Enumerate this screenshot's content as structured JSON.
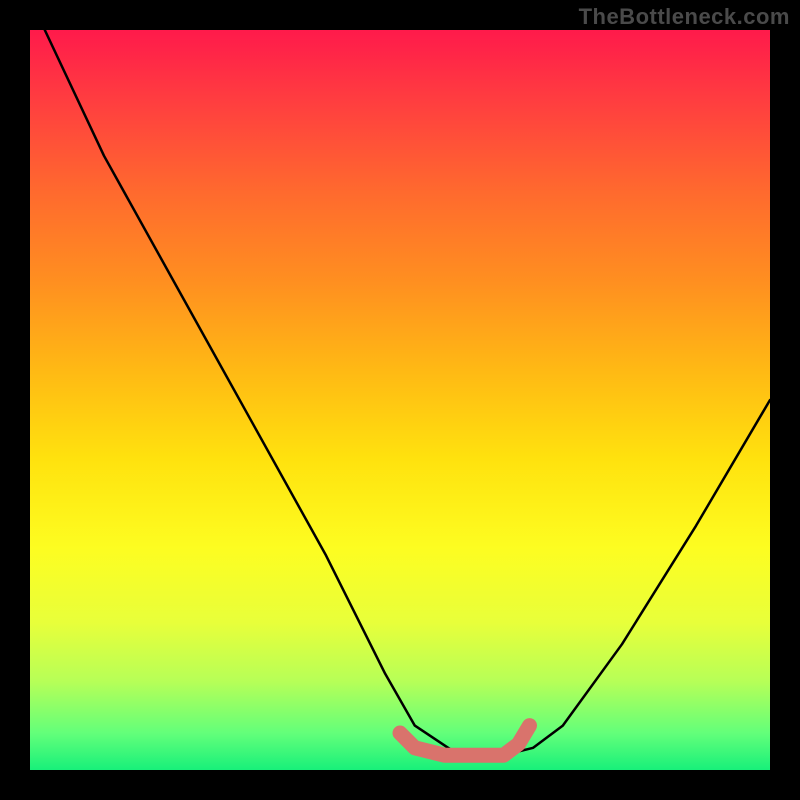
{
  "watermark": "TheBottleneck.com",
  "chart_data": {
    "type": "line",
    "title": "",
    "xlabel": "",
    "ylabel": "",
    "xlim": [
      0,
      100
    ],
    "ylim": [
      0,
      100
    ],
    "series": [
      {
        "name": "bottleneck-curve",
        "x": [
          2,
          10,
          20,
          30,
          40,
          48,
          52,
          58,
          64,
          68,
          72,
          80,
          90,
          100
        ],
        "y": [
          100,
          83,
          65,
          47,
          29,
          13,
          6,
          2,
          2,
          3,
          6,
          17,
          33,
          50
        ]
      }
    ],
    "highlight": {
      "name": "optimal-range",
      "x": [
        50,
        52,
        56,
        60,
        64,
        66,
        67.5
      ],
      "y": [
        5,
        3,
        2,
        2,
        2,
        3.5,
        6
      ],
      "color": "#d9736c"
    },
    "gradient_stops": [
      {
        "pos": 0,
        "color": "#ff1a4b"
      },
      {
        "pos": 22,
        "color": "#ff6a2e"
      },
      {
        "pos": 46,
        "color": "#ffb914"
      },
      {
        "pos": 70,
        "color": "#fdfd21"
      },
      {
        "pos": 95,
        "color": "#63ff7a"
      },
      {
        "pos": 100,
        "color": "#18f07a"
      }
    ]
  }
}
